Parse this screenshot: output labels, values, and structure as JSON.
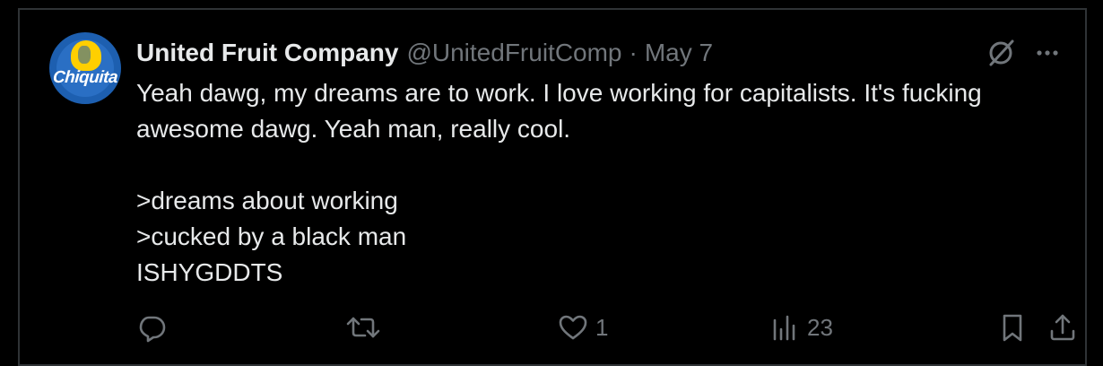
{
  "post": {
    "author_name": "United Fruit Company",
    "author_handle": "@UnitedFruitComp",
    "separator": "·",
    "date": "May 7",
    "avatar_text": "Chiquita",
    "body_lines": [
      "Yeah dawg, my dreams are to work. I love working for capitalists. It's fucking awesome dawg. Yeah man, really cool.",
      ">dreams about working",
      ">cucked by a black man",
      "ISHYGDDTS"
    ]
  },
  "actions": {
    "reply_count": "",
    "repost_count": "",
    "like_count": "1",
    "views_count": "23"
  },
  "icons": {
    "grok": "grok-icon",
    "more": "more-icon",
    "reply": "reply-icon",
    "repost": "repost-icon",
    "like": "heart-icon",
    "views": "analytics-icon",
    "bookmark": "bookmark-icon",
    "share": "share-icon"
  },
  "colors": {
    "background": "#000000",
    "border": "#2f3336",
    "text_primary": "#e7e9ea",
    "text_secondary": "#71767b"
  }
}
